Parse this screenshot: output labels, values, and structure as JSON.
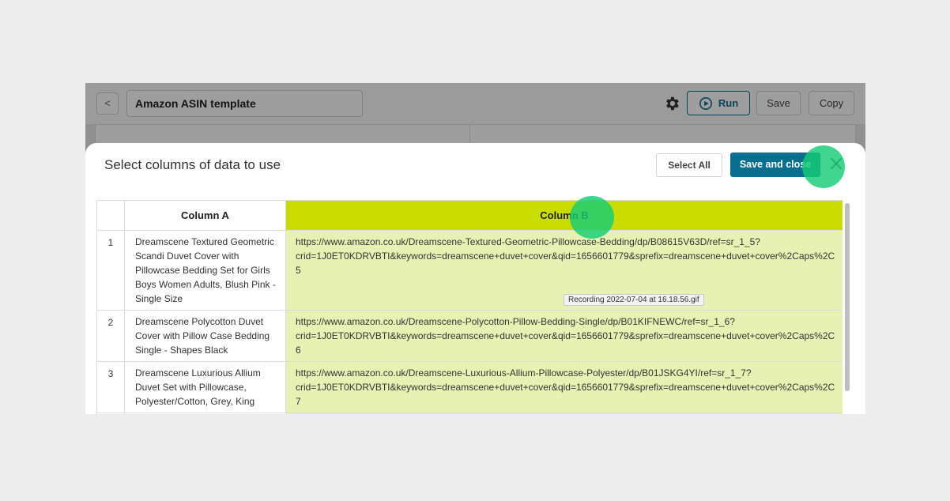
{
  "header": {
    "back_label": "<",
    "template_name": "Amazon ASIN template",
    "settings_icon": "gear-icon",
    "run_label": "Run",
    "run_icon": "play-circle-icon",
    "save_label": "Save",
    "copy_label": "Copy"
  },
  "modal": {
    "title": "Select columns of data to use",
    "select_all_label": "Select All",
    "save_and_close_label": "Save and close",
    "close_icon": "close-icon"
  },
  "table": {
    "columns": [
      "Column A",
      "Column B"
    ],
    "rows": [
      {
        "num": "1",
        "a": "Dreamscene Textured Geometric Scandi Duvet Cover with Pillowcase Bedding Set for Girls Boys Women Adults, Blush Pink - Single Size",
        "b": "https://www.amazon.co.uk/Dreamscene-Textured-Geometric-Pillowcase-Bedding/dp/B08615V63D/ref=sr_1_5?\ncrid=1J0ET0KDRVBTI&keywords=dreamscene+duvet+cover&qid=1656601779&sprefix=dreamscene+duvet+cover%2Caps%2C\n5"
      },
      {
        "num": "2",
        "a": "Dreamscene Polycotton Duvet Cover with Pillow Case Bedding Single - Shapes Black",
        "b": "https://www.amazon.co.uk/Dreamscene-Polycotton-Pillow-Bedding-Single/dp/B01KIFNEWC/ref=sr_1_6?\ncrid=1J0ET0KDRVBTI&keywords=dreamscene+duvet+cover&qid=1656601779&sprefix=dreamscene+duvet+cover%2Caps%2C\n6"
      },
      {
        "num": "3",
        "a": "Dreamscene Luxurious Allium Duvet Set with Pillowcase, Polyester/Cotton, Grey, King",
        "b": "https://www.amazon.co.uk/Dreamscene-Luxurious-Allium-Pillowcase-Polyester/dp/B01JSKG4YI/ref=sr_1_7?\ncrid=1J0ET0KDRVBTI&keywords=dreamscene+duvet+cover&qid=1656601779&sprefix=dreamscene+duvet+cover%2Caps%2C\n7"
      }
    ]
  },
  "tooltip": "Recording 2022-07-04 at 16.18.56.gif",
  "colors": {
    "accent": "#0a6e8e",
    "selected_header": "#c8dc00",
    "selected_cells": "#e7f1b3",
    "click_marker": "#16cc76"
  }
}
